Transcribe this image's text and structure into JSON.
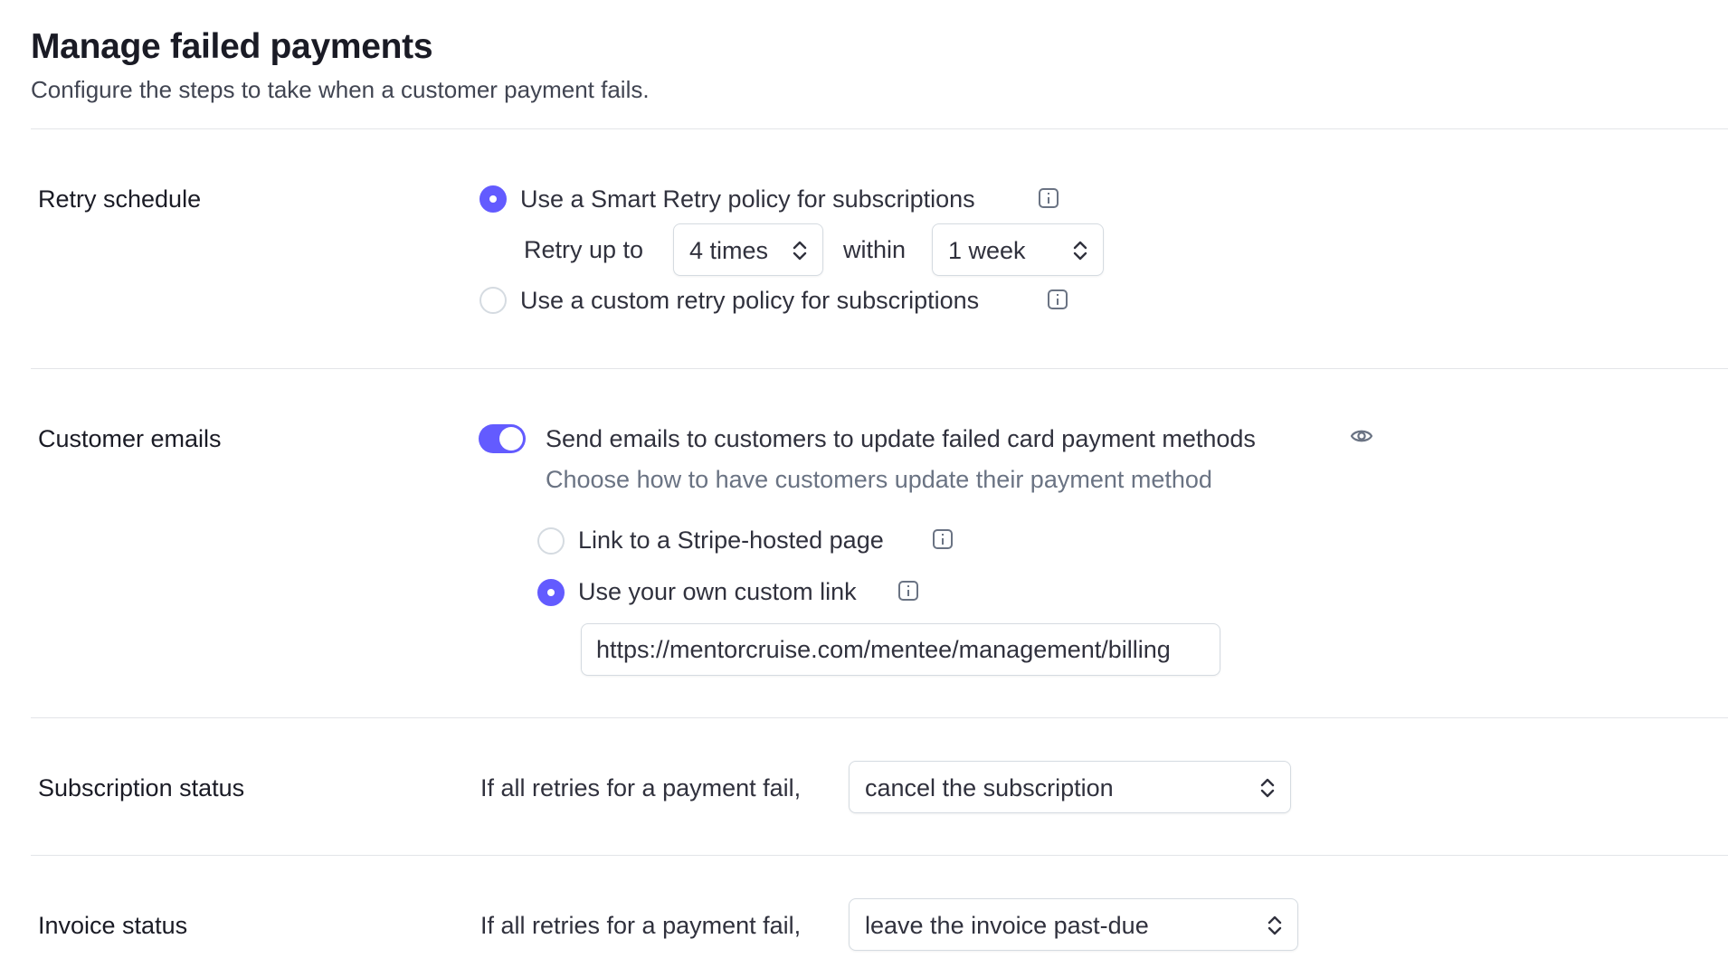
{
  "page": {
    "title": "Manage failed payments",
    "subtitle": "Configure the steps to take when a customer payment fails."
  },
  "retry_schedule": {
    "label": "Retry schedule",
    "smart_option": "Use a Smart Retry policy for subscriptions",
    "retry_prefix": "Retry up to",
    "times_value": "4 times",
    "within_text": "within",
    "period_value": "1 week",
    "custom_option": "Use a custom retry policy for subscriptions",
    "selected": "smart"
  },
  "customer_emails": {
    "label": "Customer emails",
    "toggle_on": true,
    "toggle_label": "Send emails to customers to update failed card payment methods",
    "description": "Choose how to have customers update their payment method",
    "stripe_option": "Link to a Stripe-hosted page",
    "custom_option": "Use your own custom link",
    "custom_link_value": "https://mentorcruise.com/mentee/management/billing",
    "selected": "custom"
  },
  "subscription_status": {
    "label": "Subscription status",
    "prefix": "If all retries for a payment fail,",
    "value": "cancel the subscription"
  },
  "invoice_status": {
    "label": "Invoice status",
    "prefix": "If all retries for a payment fail,",
    "value": "leave the invoice past-due"
  },
  "colors": {
    "accent": "#635bff",
    "text": "#30313d",
    "muted": "#6a7383",
    "border": "#d5dbe1"
  },
  "icons": [
    "info-icon",
    "eye-icon",
    "chevron-up-down-icon"
  ]
}
